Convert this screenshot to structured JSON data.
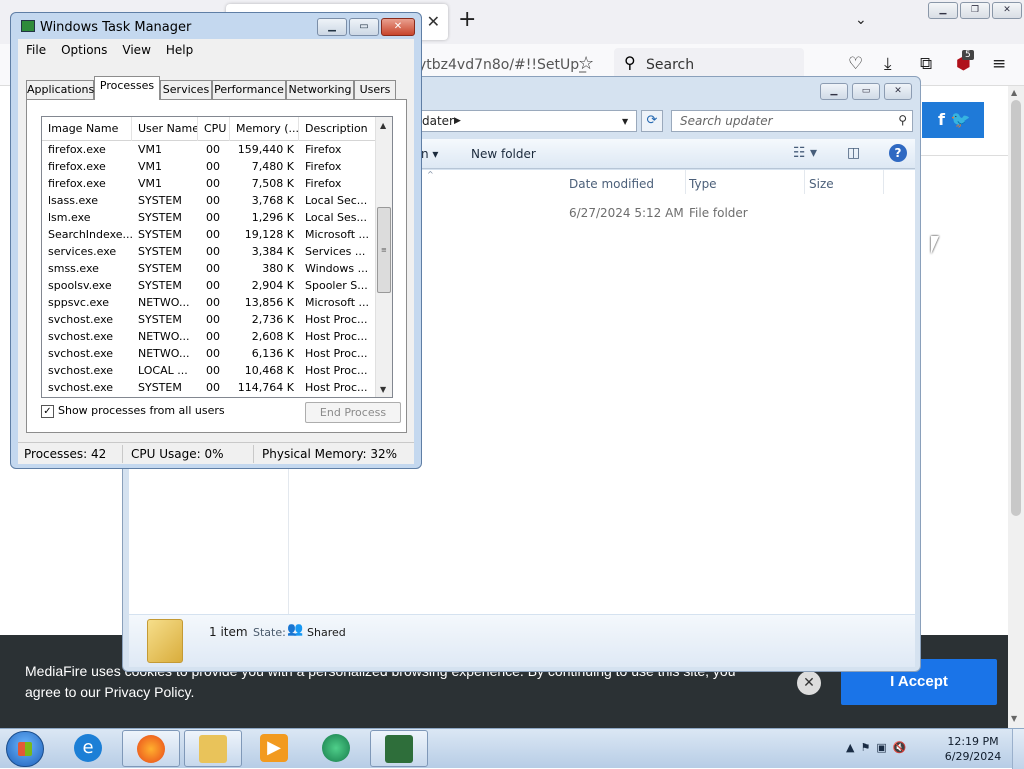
{
  "browser": {
    "url_fragment": "ytbz4vd7n8o/#!!SetUp_",
    "search_label": "Search",
    "badge_count": "5",
    "new_tab_symbol": "+",
    "tab_close_symbol": "✕"
  },
  "cookie": {
    "text": "MediaFire uses cookies to provide you with a personalized browsing experience. By continuing to use this site, you agree to our Privacy Policy.",
    "accept_label": "I Accept"
  },
  "explorer": {
    "address_crumb": "dater",
    "search_placeholder": "Search updater",
    "toolbar": {
      "new_folder_label": "New folder"
    },
    "columns": [
      "Date modified",
      "Type",
      "Size"
    ],
    "rows": [
      {
        "date_modified": "6/27/2024 5:12 AM",
        "type": "File folder",
        "size": ""
      }
    ],
    "details": {
      "count": "1 item",
      "state_label": "State:",
      "state_value": "Shared"
    }
  },
  "taskmgr": {
    "title": "Windows Task Manager",
    "menu": [
      "File",
      "Options",
      "View",
      "Help"
    ],
    "tabs": [
      "Applications",
      "Processes",
      "Services",
      "Performance",
      "Networking",
      "Users"
    ],
    "active_tab": "Processes",
    "columns": [
      "Image Name",
      "User Name",
      "CPU",
      "Memory (...",
      "Description"
    ],
    "processes": [
      {
        "name": "firefox.exe",
        "user": "VM1",
        "cpu": "00",
        "mem": "159,440 K",
        "desc": "Firefox"
      },
      {
        "name": "firefox.exe",
        "user": "VM1",
        "cpu": "00",
        "mem": "7,480 K",
        "desc": "Firefox"
      },
      {
        "name": "firefox.exe",
        "user": "VM1",
        "cpu": "00",
        "mem": "7,508 K",
        "desc": "Firefox"
      },
      {
        "name": "lsass.exe",
        "user": "SYSTEM",
        "cpu": "00",
        "mem": "3,768 K",
        "desc": "Local Sec..."
      },
      {
        "name": "lsm.exe",
        "user": "SYSTEM",
        "cpu": "00",
        "mem": "1,296 K",
        "desc": "Local Ses..."
      },
      {
        "name": "SearchIndexe...",
        "user": "SYSTEM",
        "cpu": "00",
        "mem": "19,128 K",
        "desc": "Microsoft ..."
      },
      {
        "name": "services.exe",
        "user": "SYSTEM",
        "cpu": "00",
        "mem": "3,384 K",
        "desc": "Services ..."
      },
      {
        "name": "smss.exe",
        "user": "SYSTEM",
        "cpu": "00",
        "mem": "380 K",
        "desc": "Windows ..."
      },
      {
        "name": "spoolsv.exe",
        "user": "SYSTEM",
        "cpu": "00",
        "mem": "2,904 K",
        "desc": "Spooler S..."
      },
      {
        "name": "sppsvc.exe",
        "user": "NETWO...",
        "cpu": "00",
        "mem": "13,856 K",
        "desc": "Microsoft ..."
      },
      {
        "name": "svchost.exe",
        "user": "SYSTEM",
        "cpu": "00",
        "mem": "2,736 K",
        "desc": "Host Proc..."
      },
      {
        "name": "svchost.exe",
        "user": "NETWO...",
        "cpu": "00",
        "mem": "2,608 K",
        "desc": "Host Proc..."
      },
      {
        "name": "svchost.exe",
        "user": "NETWO...",
        "cpu": "00",
        "mem": "6,136 K",
        "desc": "Host Proc..."
      },
      {
        "name": "svchost.exe",
        "user": "LOCAL ...",
        "cpu": "00",
        "mem": "10,468 K",
        "desc": "Host Proc..."
      },
      {
        "name": "svchost.exe",
        "user": "SYSTEM",
        "cpu": "00",
        "mem": "114,764 K",
        "desc": "Host Proc..."
      }
    ],
    "show_all_label": "Show processes from all users",
    "show_all_checked": true,
    "end_process_label": "End Process",
    "status": {
      "processes": "Processes: 42",
      "cpu": "CPU Usage: 0%",
      "memory": "Physical Memory: 32%"
    }
  },
  "taskbar": {
    "time": "12:19 PM",
    "date": "6/29/2024",
    "apps": [
      "internet-explorer",
      "firefox",
      "file-explorer",
      "media-player",
      "app-green",
      "task-manager"
    ]
  }
}
